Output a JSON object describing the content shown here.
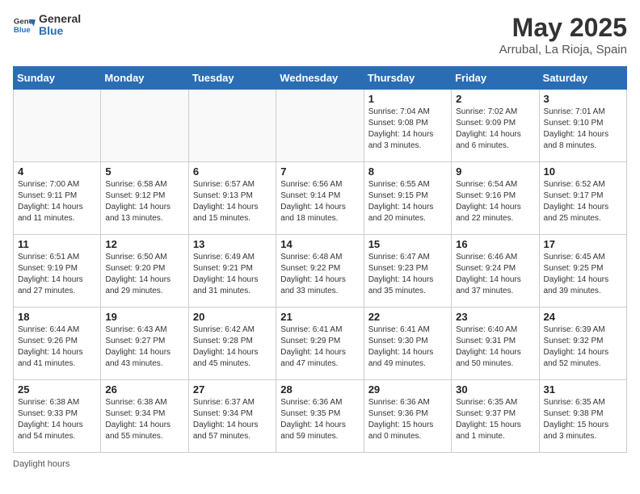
{
  "header": {
    "logo_line1": "General",
    "logo_line2": "Blue",
    "month_year": "May 2025",
    "location": "Arrubal, La Rioja, Spain"
  },
  "days_of_week": [
    "Sunday",
    "Monday",
    "Tuesday",
    "Wednesday",
    "Thursday",
    "Friday",
    "Saturday"
  ],
  "weeks": [
    [
      {
        "num": "",
        "info": ""
      },
      {
        "num": "",
        "info": ""
      },
      {
        "num": "",
        "info": ""
      },
      {
        "num": "",
        "info": ""
      },
      {
        "num": "1",
        "info": "Sunrise: 7:04 AM\nSunset: 9:08 PM\nDaylight: 14 hours\nand 3 minutes."
      },
      {
        "num": "2",
        "info": "Sunrise: 7:02 AM\nSunset: 9:09 PM\nDaylight: 14 hours\nand 6 minutes."
      },
      {
        "num": "3",
        "info": "Sunrise: 7:01 AM\nSunset: 9:10 PM\nDaylight: 14 hours\nand 8 minutes."
      }
    ],
    [
      {
        "num": "4",
        "info": "Sunrise: 7:00 AM\nSunset: 9:11 PM\nDaylight: 14 hours\nand 11 minutes."
      },
      {
        "num": "5",
        "info": "Sunrise: 6:58 AM\nSunset: 9:12 PM\nDaylight: 14 hours\nand 13 minutes."
      },
      {
        "num": "6",
        "info": "Sunrise: 6:57 AM\nSunset: 9:13 PM\nDaylight: 14 hours\nand 15 minutes."
      },
      {
        "num": "7",
        "info": "Sunrise: 6:56 AM\nSunset: 9:14 PM\nDaylight: 14 hours\nand 18 minutes."
      },
      {
        "num": "8",
        "info": "Sunrise: 6:55 AM\nSunset: 9:15 PM\nDaylight: 14 hours\nand 20 minutes."
      },
      {
        "num": "9",
        "info": "Sunrise: 6:54 AM\nSunset: 9:16 PM\nDaylight: 14 hours\nand 22 minutes."
      },
      {
        "num": "10",
        "info": "Sunrise: 6:52 AM\nSunset: 9:17 PM\nDaylight: 14 hours\nand 25 minutes."
      }
    ],
    [
      {
        "num": "11",
        "info": "Sunrise: 6:51 AM\nSunset: 9:19 PM\nDaylight: 14 hours\nand 27 minutes."
      },
      {
        "num": "12",
        "info": "Sunrise: 6:50 AM\nSunset: 9:20 PM\nDaylight: 14 hours\nand 29 minutes."
      },
      {
        "num": "13",
        "info": "Sunrise: 6:49 AM\nSunset: 9:21 PM\nDaylight: 14 hours\nand 31 minutes."
      },
      {
        "num": "14",
        "info": "Sunrise: 6:48 AM\nSunset: 9:22 PM\nDaylight: 14 hours\nand 33 minutes."
      },
      {
        "num": "15",
        "info": "Sunrise: 6:47 AM\nSunset: 9:23 PM\nDaylight: 14 hours\nand 35 minutes."
      },
      {
        "num": "16",
        "info": "Sunrise: 6:46 AM\nSunset: 9:24 PM\nDaylight: 14 hours\nand 37 minutes."
      },
      {
        "num": "17",
        "info": "Sunrise: 6:45 AM\nSunset: 9:25 PM\nDaylight: 14 hours\nand 39 minutes."
      }
    ],
    [
      {
        "num": "18",
        "info": "Sunrise: 6:44 AM\nSunset: 9:26 PM\nDaylight: 14 hours\nand 41 minutes."
      },
      {
        "num": "19",
        "info": "Sunrise: 6:43 AM\nSunset: 9:27 PM\nDaylight: 14 hours\nand 43 minutes."
      },
      {
        "num": "20",
        "info": "Sunrise: 6:42 AM\nSunset: 9:28 PM\nDaylight: 14 hours\nand 45 minutes."
      },
      {
        "num": "21",
        "info": "Sunrise: 6:41 AM\nSunset: 9:29 PM\nDaylight: 14 hours\nand 47 minutes."
      },
      {
        "num": "22",
        "info": "Sunrise: 6:41 AM\nSunset: 9:30 PM\nDaylight: 14 hours\nand 49 minutes."
      },
      {
        "num": "23",
        "info": "Sunrise: 6:40 AM\nSunset: 9:31 PM\nDaylight: 14 hours\nand 50 minutes."
      },
      {
        "num": "24",
        "info": "Sunrise: 6:39 AM\nSunset: 9:32 PM\nDaylight: 14 hours\nand 52 minutes."
      }
    ],
    [
      {
        "num": "25",
        "info": "Sunrise: 6:38 AM\nSunset: 9:33 PM\nDaylight: 14 hours\nand 54 minutes."
      },
      {
        "num": "26",
        "info": "Sunrise: 6:38 AM\nSunset: 9:34 PM\nDaylight: 14 hours\nand 55 minutes."
      },
      {
        "num": "27",
        "info": "Sunrise: 6:37 AM\nSunset: 9:34 PM\nDaylight: 14 hours\nand 57 minutes."
      },
      {
        "num": "28",
        "info": "Sunrise: 6:36 AM\nSunset: 9:35 PM\nDaylight: 14 hours\nand 59 minutes."
      },
      {
        "num": "29",
        "info": "Sunrise: 6:36 AM\nSunset: 9:36 PM\nDaylight: 15 hours\nand 0 minutes."
      },
      {
        "num": "30",
        "info": "Sunrise: 6:35 AM\nSunset: 9:37 PM\nDaylight: 15 hours\nand 1 minute."
      },
      {
        "num": "31",
        "info": "Sunrise: 6:35 AM\nSunset: 9:38 PM\nDaylight: 15 hours\nand 3 minutes."
      }
    ]
  ],
  "footer": "Daylight hours"
}
